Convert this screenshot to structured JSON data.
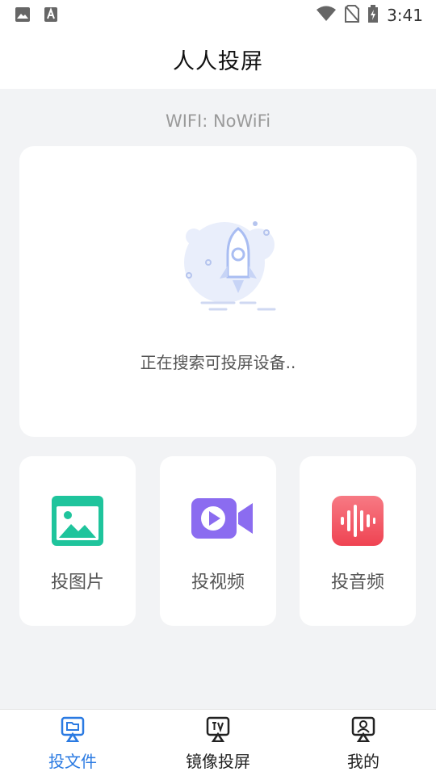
{
  "status_bar": {
    "time": "3:41",
    "left_icons": [
      "image-icon",
      "text-a-icon"
    ],
    "right_icons": [
      "wifi-icon",
      "no-sim-icon",
      "battery-charging-icon"
    ]
  },
  "header": {
    "title": "人人投屏"
  },
  "wifi": {
    "label": "WIFI: NoWiFi"
  },
  "search": {
    "status_text": "正在搜索可投屏设备..",
    "illustration": "rocket-icon"
  },
  "features": [
    {
      "label": "投图片",
      "icon": "image-icon",
      "color": "#1fc49c"
    },
    {
      "label": "投视频",
      "icon": "video-icon",
      "color": "#8b6cf0"
    },
    {
      "label": "投音频",
      "icon": "audio-icon",
      "color": "#f2545f"
    }
  ],
  "bottom_nav": {
    "items": [
      {
        "label": "投文件",
        "icon": "cast-file-icon",
        "active": true
      },
      {
        "label": "镜像投屏",
        "icon": "tv-mirror-icon",
        "active": false
      },
      {
        "label": "我的",
        "icon": "profile-icon",
        "active": false
      }
    ]
  },
  "colors": {
    "accent": "#2a7ae2",
    "background": "#f2f3f5"
  }
}
